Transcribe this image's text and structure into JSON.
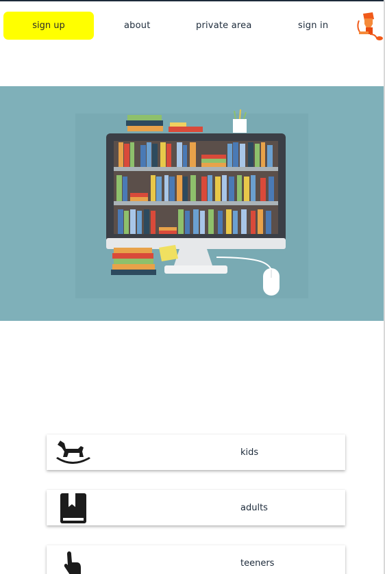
{
  "nav": {
    "signup_label": "sign up",
    "about_label": "about",
    "private_area_label": "private area",
    "signin_label": "sign in",
    "signup_color": "#ffff00",
    "logo_icon": "reader-at-desk-icon"
  },
  "hero": {
    "image": "bookshelf-computer-illustration",
    "background": "#7fb0b9"
  },
  "categories": [
    {
      "label": "kids",
      "icon": "rocking-horse-icon"
    },
    {
      "label": "adults",
      "icon": "book-icon"
    },
    {
      "label": "teeners",
      "icon": "pointing-hand-icon"
    }
  ]
}
